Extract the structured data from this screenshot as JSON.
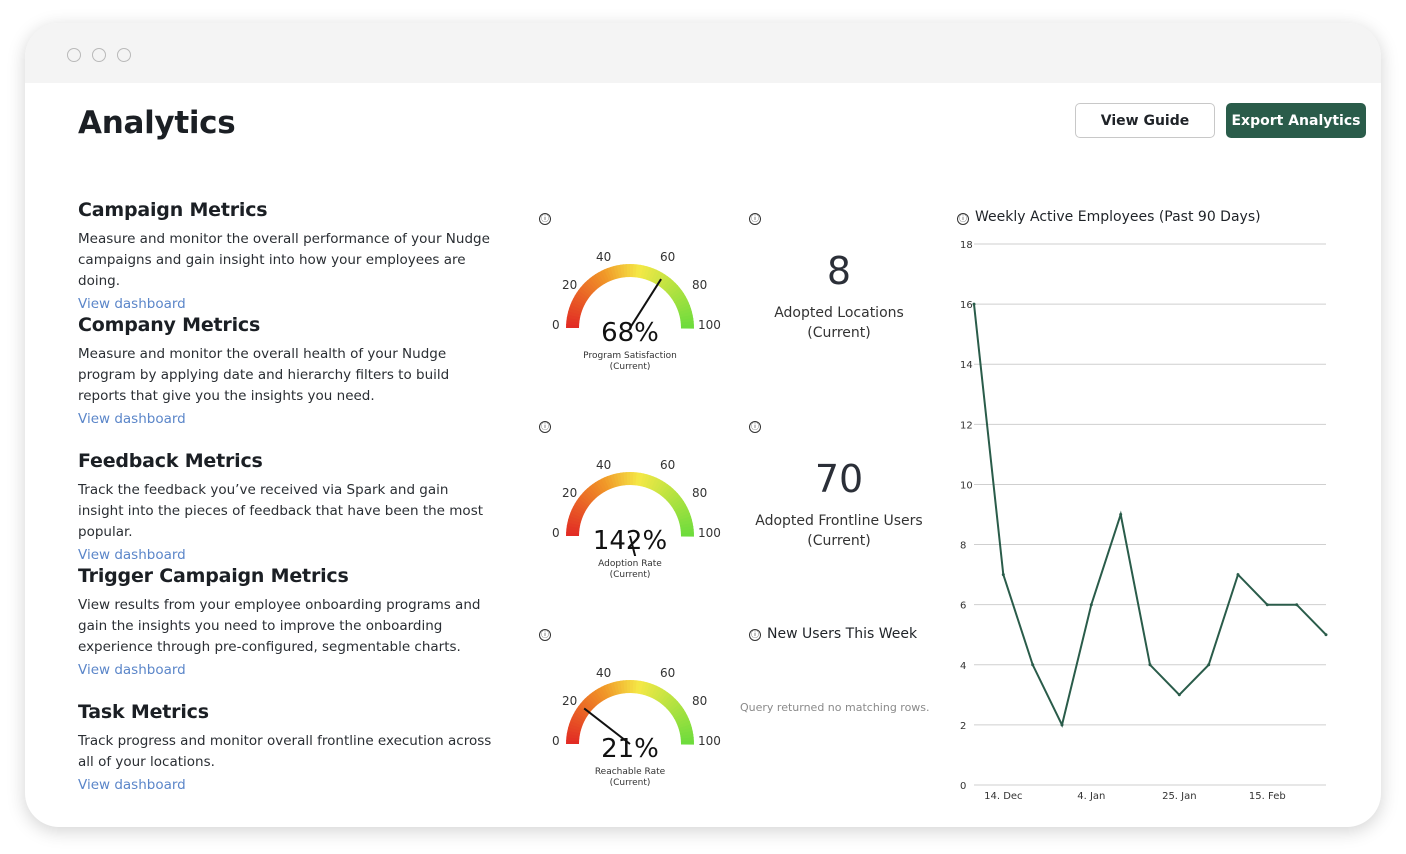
{
  "page": {
    "title": "Analytics"
  },
  "buttons": {
    "guide": "View Guide",
    "export": "Export Analytics"
  },
  "sections": [
    {
      "title": "Campaign Metrics",
      "desc": "Measure and monitor the overall performance of your Nudge campaigns and gain insight into how your employees are doing.",
      "link": "View dashboard"
    },
    {
      "title": "Company Metrics",
      "desc": "Measure and monitor the overall health of your Nudge program by applying date and hierarchy filters to build reports that give you the insights you need.",
      "link": "View dashboard"
    },
    {
      "title": "Feedback Metrics",
      "desc": "Track the feedback you’ve received via Spark and gain insight into the pieces of feedback that have been the most popular.",
      "link": "View dashboard"
    },
    {
      "title": "Trigger Campaign Metrics",
      "desc": "View results from your employee onboarding programs and gain the insights you need to improve the onboarding experience through pre-configured, segmentable charts.",
      "link": "View dashboard"
    },
    {
      "title": "Task Metrics",
      "desc": "Track progress and monitor overall frontline execution across all of your locations.",
      "link": "View dashboard"
    }
  ],
  "gauges": [
    {
      "value": 68,
      "value_text": "68%",
      "label": "Program Satisfaction",
      "sub": "(Current)"
    },
    {
      "value": 142,
      "value_text": "142%",
      "label": "Adoption Rate",
      "sub": "(Current)"
    },
    {
      "value": 21,
      "value_text": "21%",
      "label": "Reachable Rate",
      "sub": "(Current)"
    }
  ],
  "gauge_ticks": [
    "0",
    "20",
    "40",
    "60",
    "80",
    "100"
  ],
  "kpis": [
    {
      "value": "8",
      "label": "Adopted Locations",
      "sub": "(Current)"
    },
    {
      "value": "70",
      "label": "Adopted Frontline Users",
      "sub": "(Current)"
    }
  ],
  "new_users": {
    "title": "New Users This Week",
    "empty_text": "Query returned no matching rows."
  },
  "info_icon": "ⓘ",
  "colors": {
    "accent": "#2a5c4a",
    "link": "#5b86c9",
    "line": "#2a5c4a"
  },
  "chart_data": {
    "type": "line",
    "title": "Weekly Active Employees (Past 90 Days)",
    "xlabel": "",
    "ylabel": "",
    "ylim": [
      0,
      18
    ],
    "yticks": [
      "0",
      "2",
      "4",
      "6",
      "8",
      "10",
      "12",
      "14",
      "16",
      "18"
    ],
    "xtick_labels": [
      "14. Dec",
      "4. Jan",
      "25. Jan",
      "15. Feb"
    ],
    "xtick_positions": [
      1,
      4,
      7,
      10
    ],
    "x": [
      0,
      1,
      2,
      3,
      4,
      5,
      6,
      7,
      8,
      9,
      10,
      11,
      12
    ],
    "values": [
      16,
      7,
      4,
      2,
      6,
      9,
      4,
      3,
      4,
      7,
      6,
      6,
      5
    ],
    "grid": true
  }
}
